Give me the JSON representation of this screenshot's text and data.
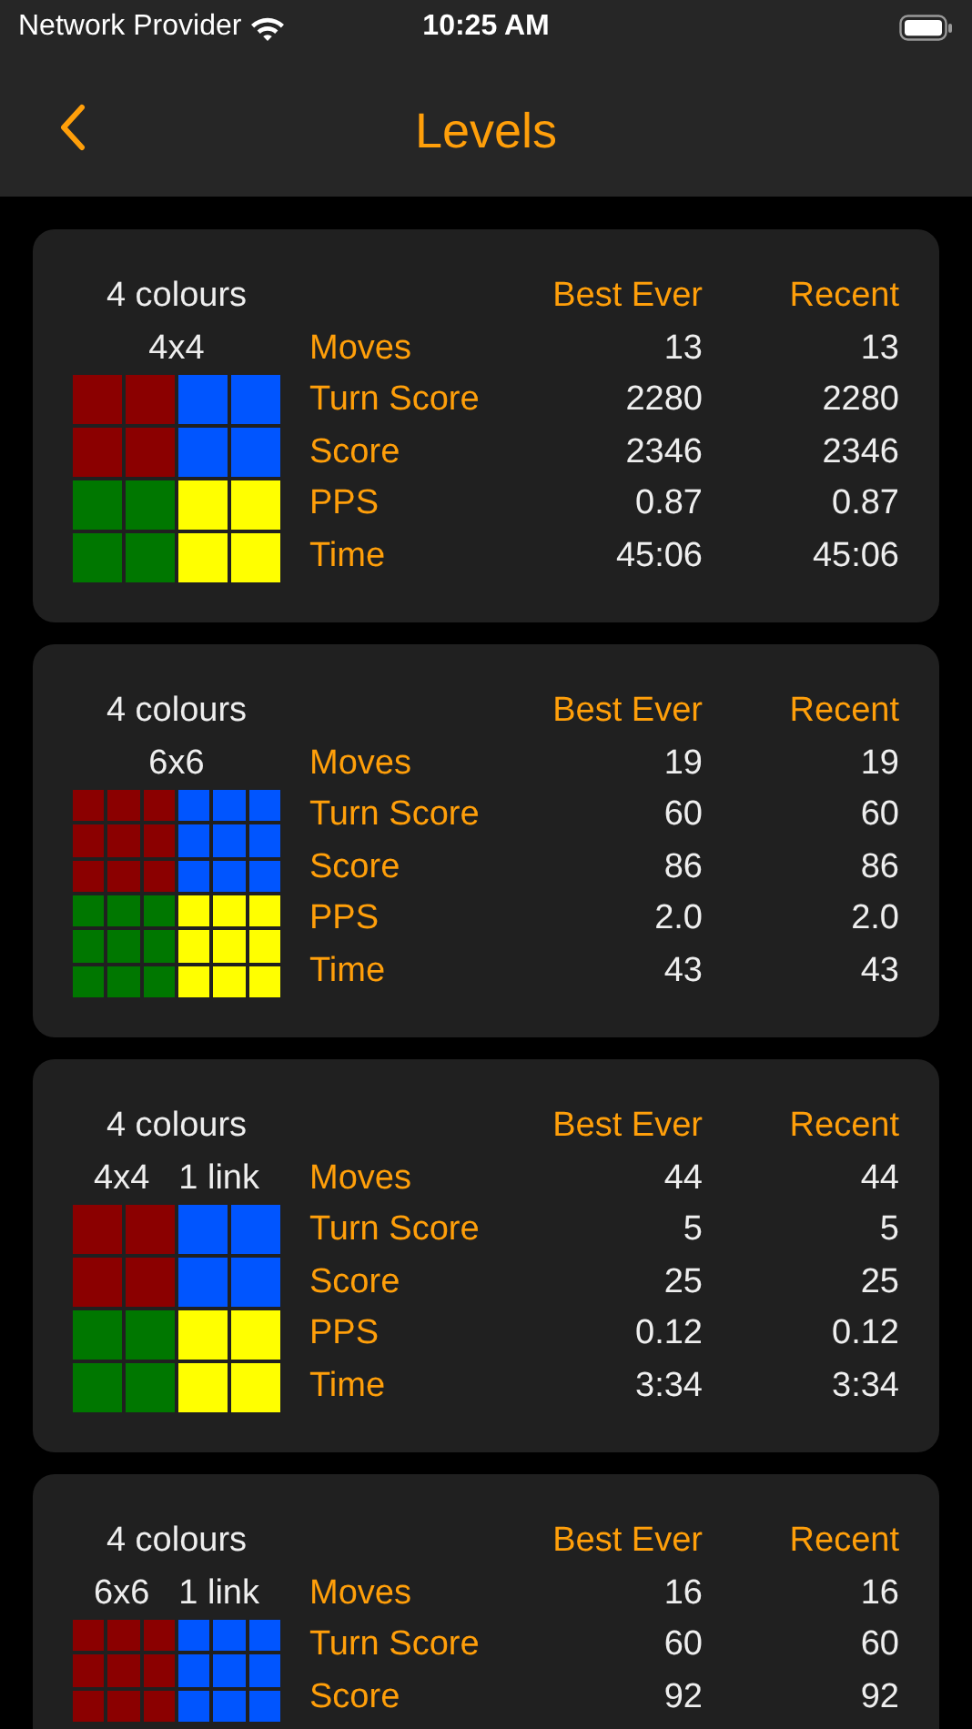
{
  "status_bar": {
    "carrier": "Network Provider",
    "time": "10:25 AM"
  },
  "nav": {
    "title": "Levels"
  },
  "levels": [
    {
      "colours": "4 colours",
      "size": "4x4",
      "header": {
        "best": "Best Ever",
        "recent": "Recent"
      },
      "board": [
        {
          "cells": [
            {
              "color": "#8b0000"
            },
            {
              "color": "#8b0000"
            },
            {
              "color": "#0055ff"
            },
            {
              "color": "#0055ff"
            }
          ]
        },
        {
          "cells": [
            {
              "color": "#8b0000"
            },
            {
              "color": "#8b0000"
            },
            {
              "color": "#0055ff"
            },
            {
              "color": "#0055ff"
            }
          ]
        },
        {
          "cells": [
            {
              "color": "#007700"
            },
            {
              "color": "#007700"
            },
            {
              "color": "#ffff00"
            },
            {
              "color": "#ffff00"
            }
          ]
        },
        {
          "cells": [
            {
              "color": "#007700"
            },
            {
              "color": "#007700"
            },
            {
              "color": "#ffff00"
            },
            {
              "color": "#ffff00"
            }
          ]
        }
      ],
      "stats": [
        {
          "label": "Moves",
          "best": "13",
          "recent": "13"
        },
        {
          "label": "Turn Score",
          "best": "2280",
          "recent": "2280"
        },
        {
          "label": "Score",
          "best": "2346",
          "recent": "2346"
        },
        {
          "label": "PPS",
          "best": "0.87",
          "recent": "0.87"
        },
        {
          "label": "Time",
          "best": "45:06",
          "recent": "45:06"
        }
      ]
    },
    {
      "colours": "4 colours",
      "size": "6x6",
      "header": {
        "best": "Best Ever",
        "recent": "Recent"
      },
      "board": [
        {
          "cells": [
            {
              "color": "#8b0000"
            },
            {
              "color": "#8b0000"
            },
            {
              "color": "#8b0000"
            },
            {
              "color": "#0055ff"
            },
            {
              "color": "#0055ff"
            },
            {
              "color": "#0055ff"
            }
          ]
        },
        {
          "cells": [
            {
              "color": "#8b0000"
            },
            {
              "color": "#8b0000"
            },
            {
              "color": "#8b0000"
            },
            {
              "color": "#0055ff"
            },
            {
              "color": "#0055ff"
            },
            {
              "color": "#0055ff"
            }
          ]
        },
        {
          "cells": [
            {
              "color": "#8b0000"
            },
            {
              "color": "#8b0000"
            },
            {
              "color": "#8b0000"
            },
            {
              "color": "#0055ff"
            },
            {
              "color": "#0055ff"
            },
            {
              "color": "#0055ff"
            }
          ]
        },
        {
          "cells": [
            {
              "color": "#007700"
            },
            {
              "color": "#007700"
            },
            {
              "color": "#007700"
            },
            {
              "color": "#ffff00"
            },
            {
              "color": "#ffff00"
            },
            {
              "color": "#ffff00"
            }
          ]
        },
        {
          "cells": [
            {
              "color": "#007700"
            },
            {
              "color": "#007700"
            },
            {
              "color": "#007700"
            },
            {
              "color": "#ffff00"
            },
            {
              "color": "#ffff00"
            },
            {
              "color": "#ffff00"
            }
          ]
        },
        {
          "cells": [
            {
              "color": "#007700"
            },
            {
              "color": "#007700"
            },
            {
              "color": "#007700"
            },
            {
              "color": "#ffff00"
            },
            {
              "color": "#ffff00"
            },
            {
              "color": "#ffff00"
            }
          ]
        }
      ],
      "stats": [
        {
          "label": "Moves",
          "best": "19",
          "recent": "19"
        },
        {
          "label": "Turn Score",
          "best": "60",
          "recent": "60"
        },
        {
          "label": "Score",
          "best": "86",
          "recent": "86"
        },
        {
          "label": "PPS",
          "best": "2.0",
          "recent": "2.0"
        },
        {
          "label": "Time",
          "best": "43",
          "recent": "43"
        }
      ]
    },
    {
      "colours": "4 colours",
      "size": "4x4",
      "link": "1 link",
      "header": {
        "best": "Best Ever",
        "recent": "Recent"
      },
      "board": [
        {
          "cells": [
            {
              "color": "#8b0000"
            },
            {
              "color": "#8b0000"
            },
            {
              "color": "#0055ff"
            },
            {
              "color": "#0055ff"
            }
          ]
        },
        {
          "cells": [
            {
              "color": "#8b0000"
            },
            {
              "color": "#8b0000"
            },
            {
              "color": "#0055ff"
            },
            {
              "color": "#0055ff"
            }
          ]
        },
        {
          "cells": [
            {
              "color": "#007700"
            },
            {
              "color": "#007700"
            },
            {
              "color": "#ffff00"
            },
            {
              "color": "#ffff00"
            }
          ]
        },
        {
          "cells": [
            {
              "color": "#007700"
            },
            {
              "color": "#007700"
            },
            {
              "color": "#ffff00"
            },
            {
              "color": "#ffff00"
            }
          ]
        }
      ],
      "stats": [
        {
          "label": "Moves",
          "best": "44",
          "recent": "44"
        },
        {
          "label": "Turn Score",
          "best": "5",
          "recent": "5"
        },
        {
          "label": "Score",
          "best": "25",
          "recent": "25"
        },
        {
          "label": "PPS",
          "best": "0.12",
          "recent": "0.12"
        },
        {
          "label": "Time",
          "best": "3:34",
          "recent": "3:34"
        }
      ]
    },
    {
      "colours": "4 colours",
      "size": "6x6",
      "link": "1 link",
      "header": {
        "best": "Best Ever",
        "recent": "Recent"
      },
      "board": [
        {
          "cells": [
            {
              "color": "#8b0000"
            },
            {
              "color": "#8b0000"
            },
            {
              "color": "#8b0000"
            },
            {
              "color": "#0055ff"
            },
            {
              "color": "#0055ff"
            },
            {
              "color": "#0055ff"
            }
          ]
        },
        {
          "cells": [
            {
              "color": "#8b0000"
            },
            {
              "color": "#8b0000"
            },
            {
              "color": "#8b0000"
            },
            {
              "color": "#0055ff"
            },
            {
              "color": "#0055ff"
            },
            {
              "color": "#0055ff"
            }
          ]
        },
        {
          "cells": [
            {
              "color": "#8b0000"
            },
            {
              "color": "#8b0000"
            },
            {
              "color": "#8b0000"
            },
            {
              "color": "#0055ff"
            },
            {
              "color": "#0055ff"
            },
            {
              "color": "#0055ff"
            }
          ]
        }
      ],
      "stats": [
        {
          "label": "Moves",
          "best": "16",
          "recent": "16"
        },
        {
          "label": "Turn Score",
          "best": "60",
          "recent": "60"
        },
        {
          "label": "Score",
          "best": "92",
          "recent": "92"
        }
      ]
    }
  ]
}
